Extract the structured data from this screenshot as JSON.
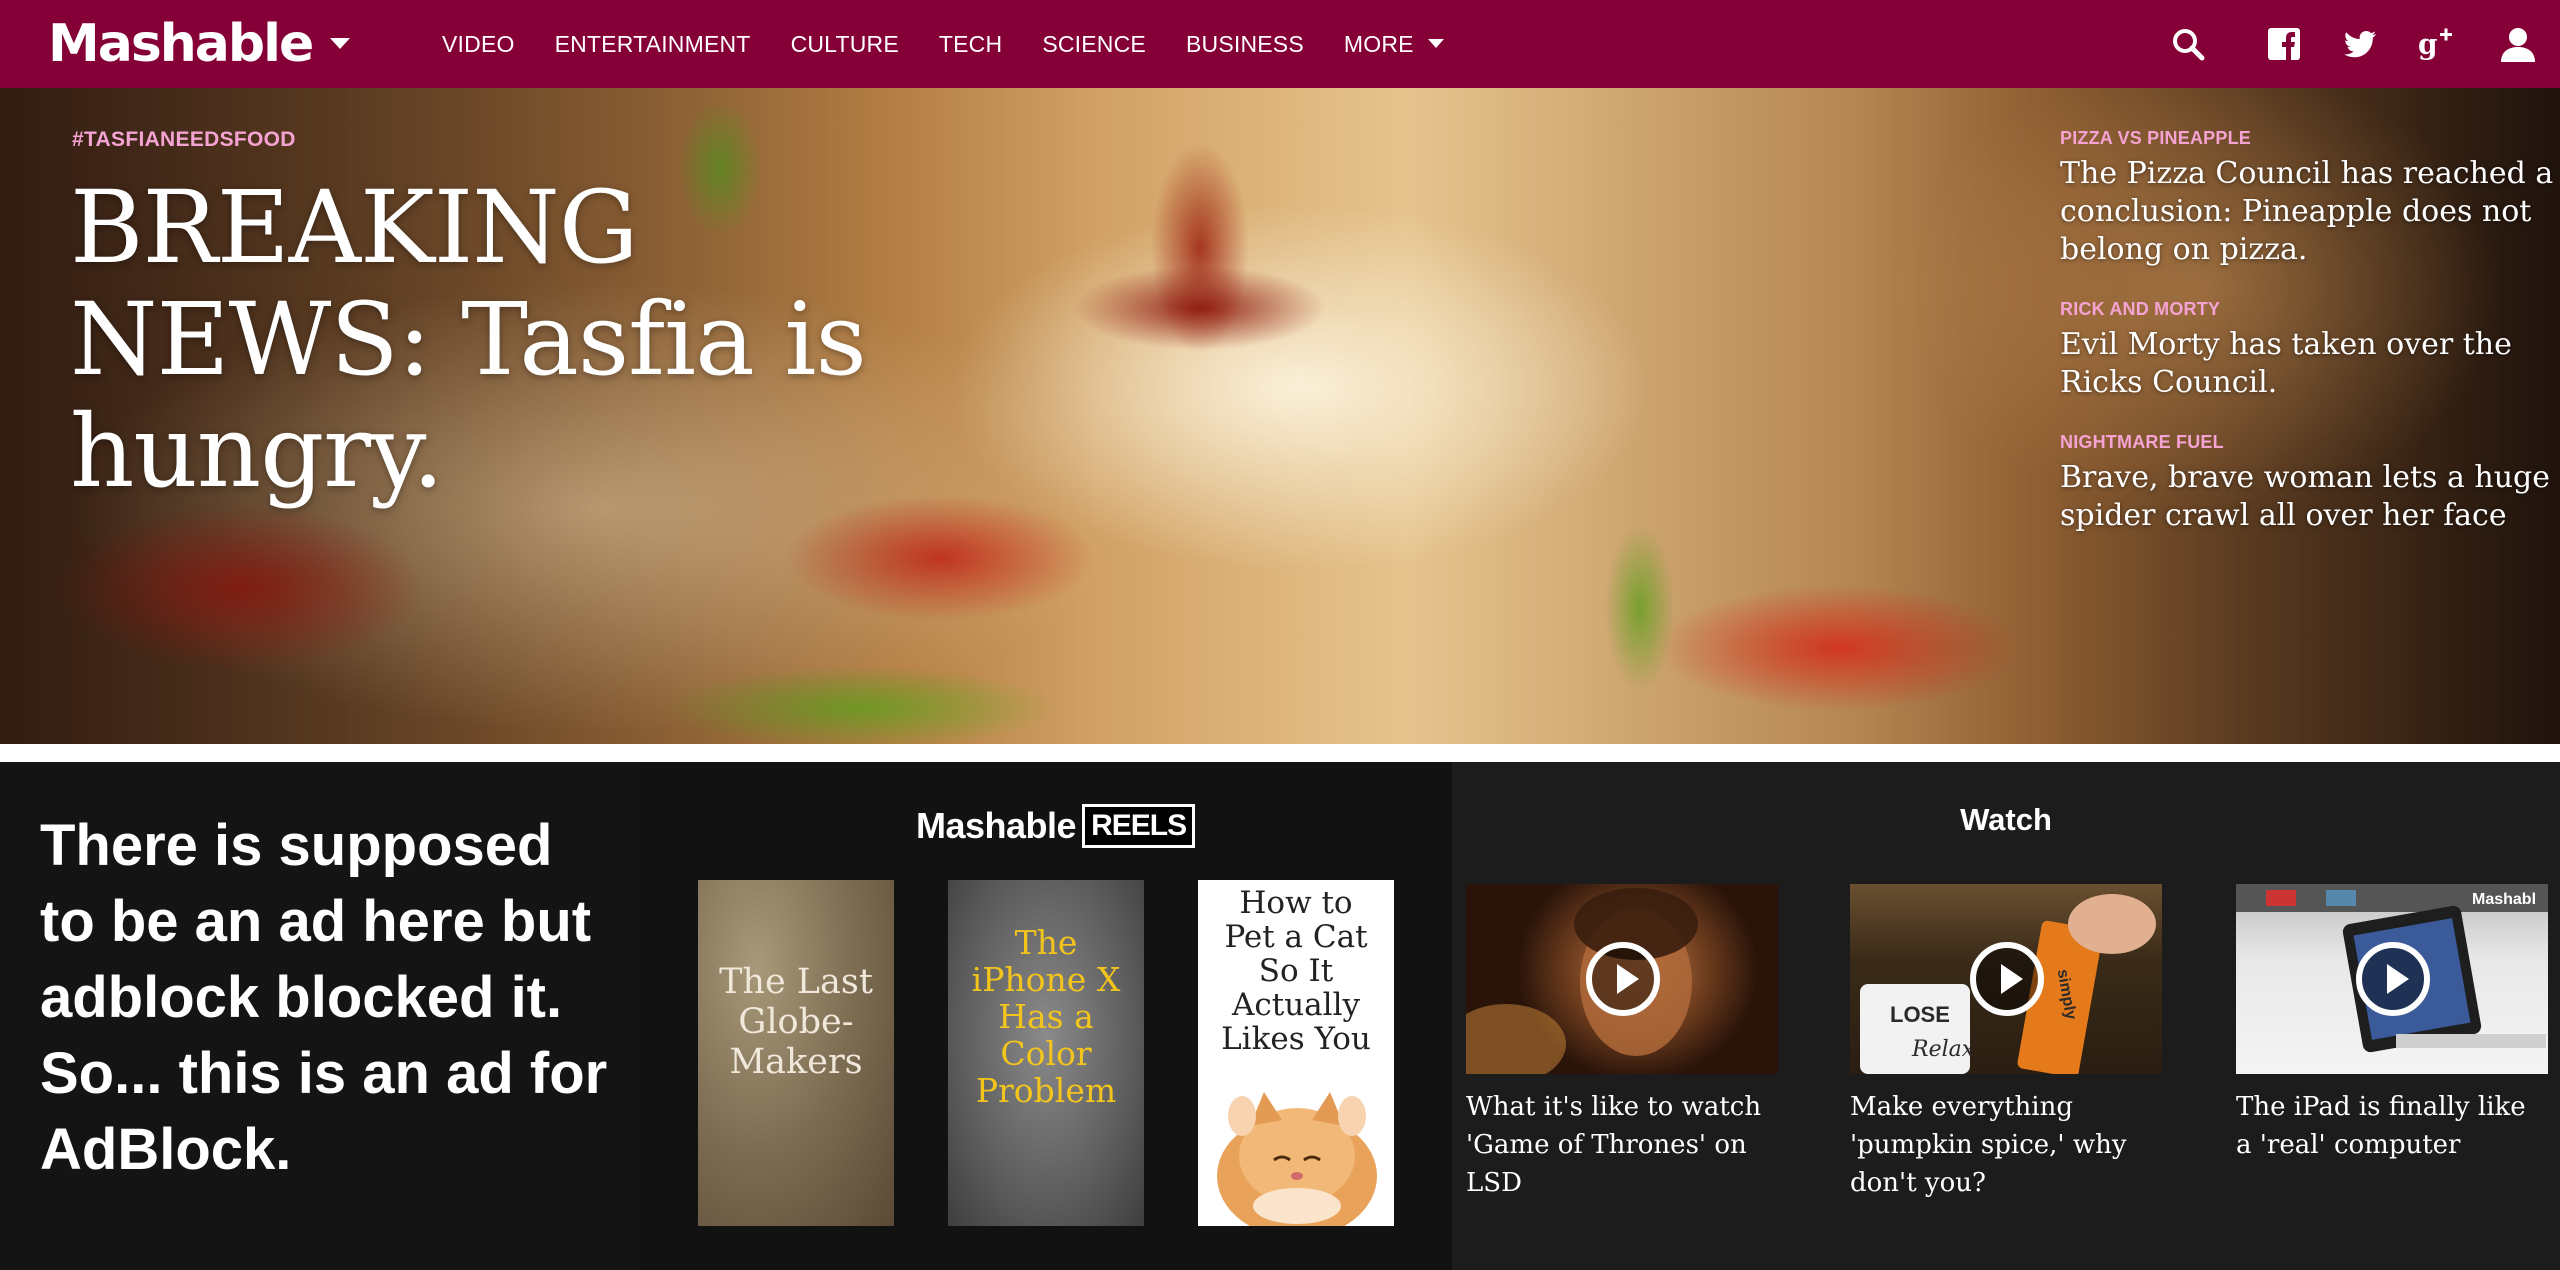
{
  "nav": {
    "logo": "Mashable",
    "links": [
      "VIDEO",
      "ENTERTAINMENT",
      "CULTURE",
      "TECH",
      "SCIENCE",
      "BUSINESS",
      "MORE"
    ],
    "icons": [
      "search-icon",
      "facebook-icon",
      "twitter-icon",
      "google-plus-icon",
      "user-icon"
    ],
    "brand_color": "#840036"
  },
  "hero": {
    "tag": "#TASFIANEEDSFOOD",
    "headline": "BREAKING NEWS: Tasfia is hungry.",
    "side_stories": [
      {
        "kicker": "PIZZA VS PINEAPPLE",
        "title": "The Pizza Council has reached a conclusion: Pineapple does not belong on pizza."
      },
      {
        "kicker": "RICK AND MORTY",
        "title": "Evil Morty has taken over the Ricks Council."
      },
      {
        "kicker": "NIGHTMARE FUEL",
        "title": "Brave, brave woman lets a huge spider crawl all over her face"
      }
    ],
    "accent_color": "#f5a3d2"
  },
  "ad": {
    "text": "There is supposed to be an ad here but adblock blocked it. So... this is an ad for AdBlock."
  },
  "reels": {
    "brand": "Mashable",
    "label": "REELS",
    "cards": [
      {
        "title": "The Last Globe-Makers"
      },
      {
        "title": "The iPhone X Has a Color Problem"
      },
      {
        "title": "How to Pet a Cat So It Actually Likes You"
      }
    ]
  },
  "watch": {
    "title": "Watch",
    "videos": [
      {
        "title": "What it's like to watch 'Game of Thrones' on LSD"
      },
      {
        "title": "Make everything 'pumpkin spice,' why don't you?",
        "mug_text": "LOSE",
        "mug_script": "Relax",
        "can_text": "simply"
      },
      {
        "title": "The iPad is finally like a 'real' computer",
        "watermark": "Mashabl"
      }
    ]
  }
}
